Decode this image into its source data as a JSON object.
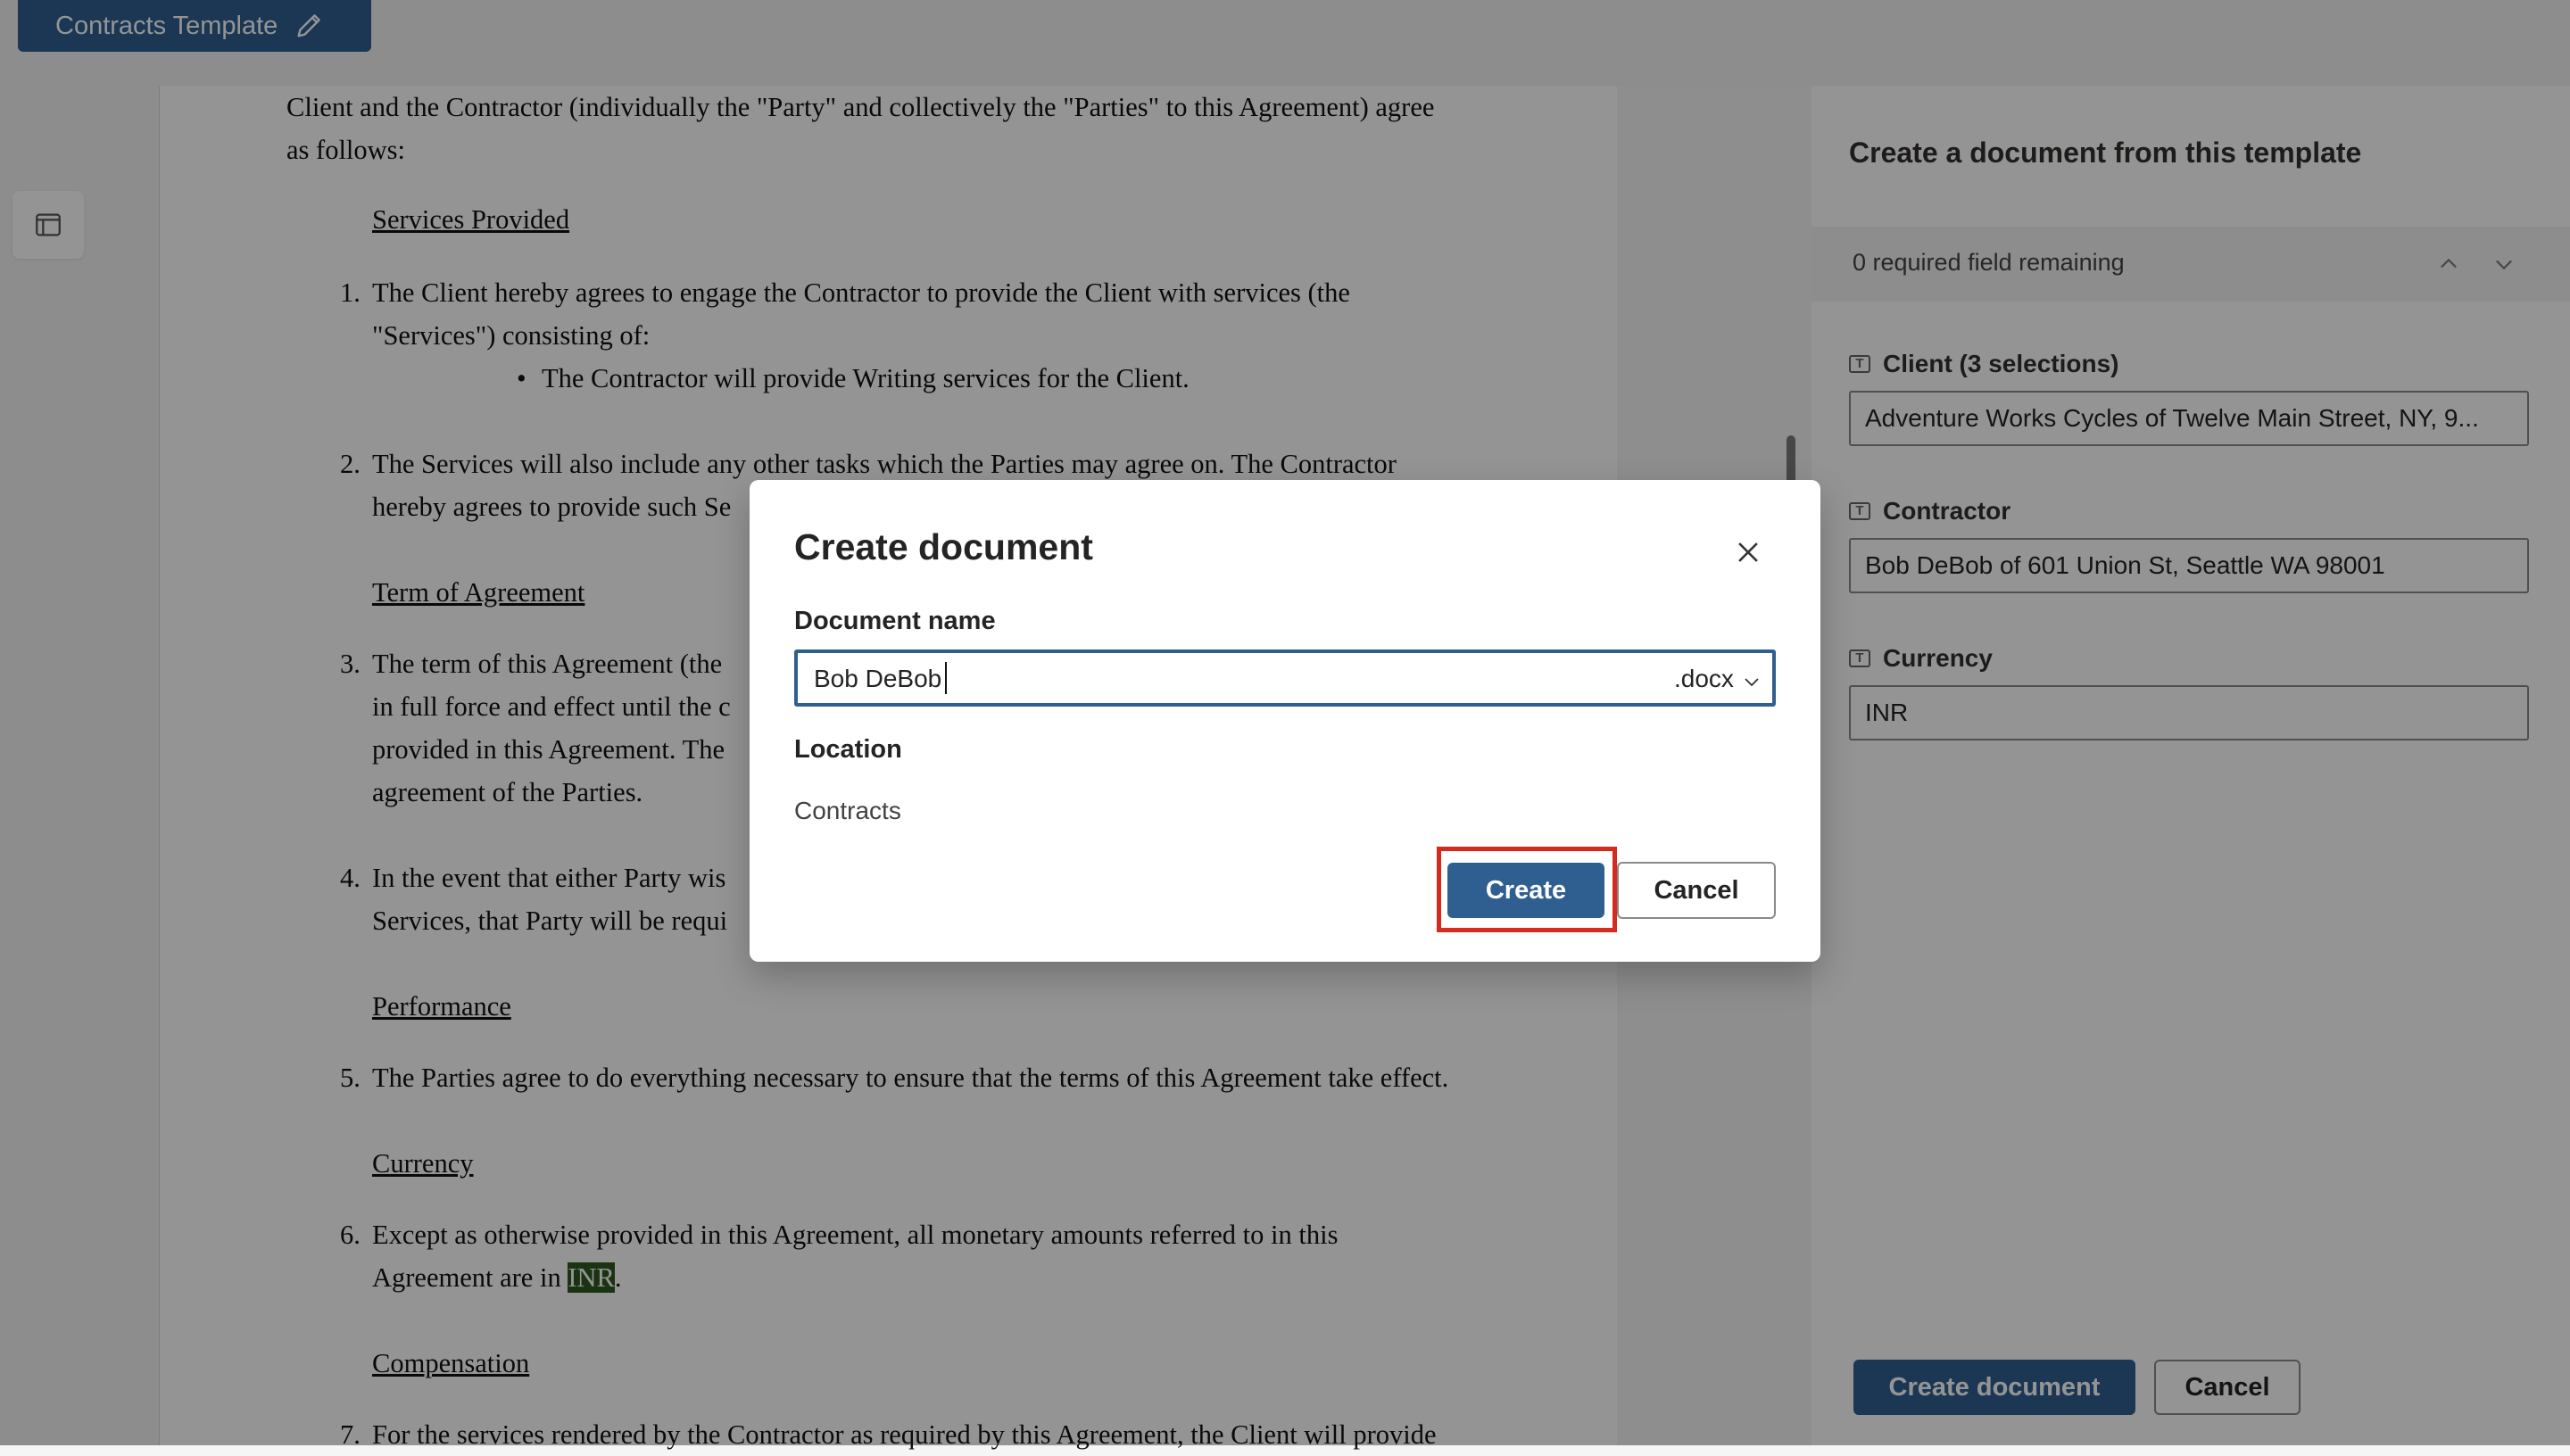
{
  "app": {
    "template_title": "Contracts Template",
    "pencil_icon": "pencil-icon",
    "panel_icon": "panel-toggle-icon"
  },
  "document": {
    "intro_line1": "Client and the Contractor (individually the \"Party\" and collectively the \"Parties\" to this Agreement) agree",
    "intro_line2": "as follows:",
    "heading_services": "Services Provided ",
    "item1_line1": "The Client hereby agrees to engage the Contractor to provide the Client with services (the",
    "item1_line2": "\"Services\") consisting of:",
    "bullet1": "The Contractor will provide Writing services for the Client.",
    "item2_line1": "The Services will also include any other tasks which the Parties may agree on. The Contractor",
    "item2_line2": "hereby agrees to provide such Se",
    "heading_term": "Term of Agreement",
    "item3_line1": "The term of this Agreement (the",
    "item3_line2": "in full force and effect until the c",
    "item3_line3": "provided in this Agreement. The",
    "item3_line4": "agreement of the Parties.",
    "item4_line1": "In the event that either Party wis",
    "item4_line2": "Services, that Party will be requi",
    "heading_performance": "Performance",
    "item5": "The Parties agree to do everything necessary to ensure that the terms of this Agreement take effect.",
    "heading_currency": "Currency",
    "item6_line1": "Except as otherwise provided in this Agreement, all monetary amounts referred to in this",
    "item6_line2_prefix": "Agreement are in ",
    "item6_currency": "INR",
    "item6_suffix": ".",
    "heading_compensation": "Compensation",
    "item7_line1": "For the services rendered by the Contractor as required by this Agreement, the Client will provide",
    "numbers": [
      "1.",
      "2.",
      "3.",
      "4.",
      "5.",
      "6.",
      "7."
    ]
  },
  "side_panel": {
    "title": "Create a document from this template",
    "required_status": "0 required field remaining",
    "fields": [
      {
        "label": "Client (3 selections)",
        "value": "Adventure Works Cycles of Twelve Main Street,  NY, 9..."
      },
      {
        "label": "Contractor",
        "value": "Bob DeBob of 601 Union St, Seattle WA 98001"
      },
      {
        "label": "Currency",
        "value": "INR"
      }
    ],
    "create_button": "Create document",
    "cancel_button": "Cancel"
  },
  "dialog": {
    "title": "Create document",
    "name_label": "Document name",
    "name_value": "Bob DeBob",
    "extension": ".docx",
    "location_label": "Location",
    "location_value": "Contracts",
    "create_button": "Create",
    "cancel_button": "Cancel"
  },
  "colors": {
    "brand_blue": "#2f5f91",
    "highlight_red": "#d42b1e",
    "inr_highlight": "#2d5b1f"
  }
}
